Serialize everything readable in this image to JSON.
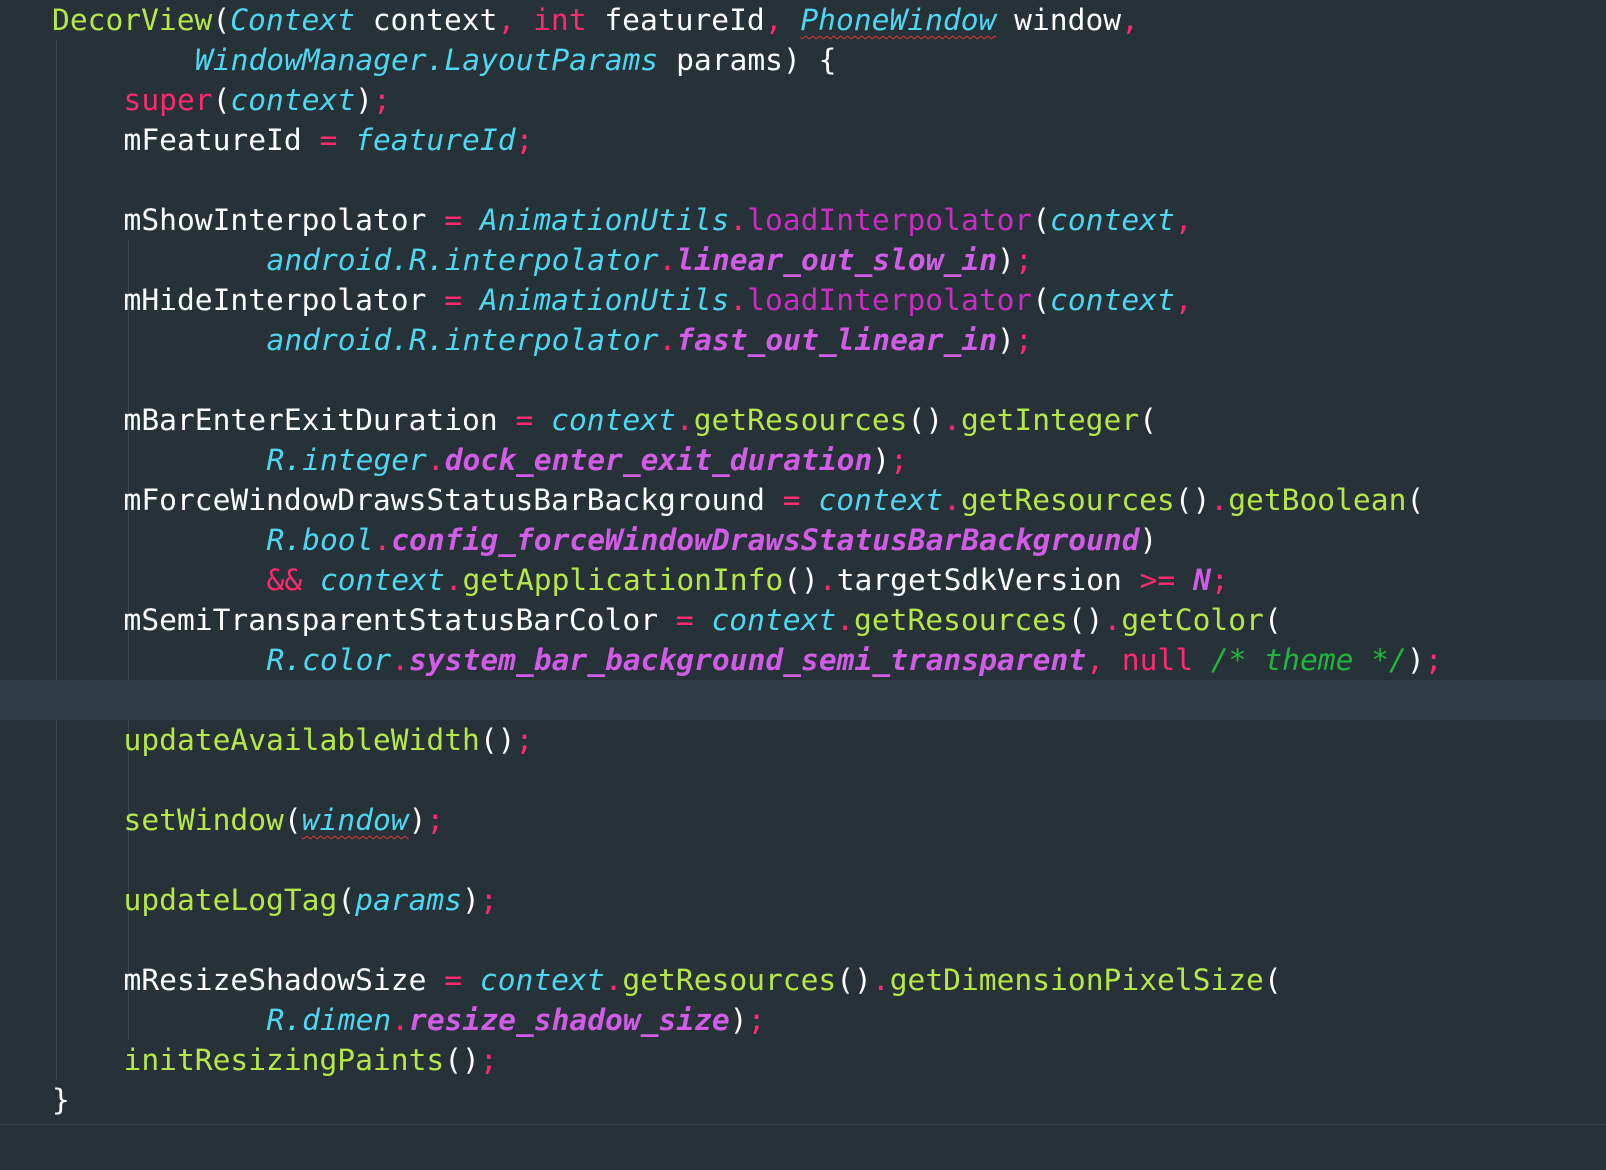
{
  "colors": {
    "background": "#263238",
    "current_line": "#2e3c44",
    "keyword": "#ff2a6d",
    "type": "#4fd6f0",
    "function": "#b4e84a",
    "library_function": "#c72ec2",
    "field": "#d15ce6",
    "comment": "#21b43f",
    "text": "#ffffff",
    "error_underline": "#d9363e"
  },
  "current_line_index": 17,
  "lines": [
    {
      "indent": 0,
      "tokens": [
        [
          "fn",
          "DecorView"
        ],
        [
          "plain",
          "("
        ],
        [
          "type",
          "Context"
        ],
        [
          "plain",
          " context"
        ],
        [
          "op",
          ", "
        ],
        [
          "kw",
          "int"
        ],
        [
          "plain",
          " featureId"
        ],
        [
          "op",
          ", "
        ],
        [
          "type squiggle",
          "PhoneWindow"
        ],
        [
          "plain",
          " window"
        ],
        [
          "op",
          ","
        ]
      ]
    },
    {
      "indent": 2,
      "tokens": [
        [
          "type",
          "WindowManager.LayoutParams"
        ],
        [
          "plain",
          " params) {"
        ]
      ]
    },
    {
      "indent": 1,
      "tokens": [
        [
          "kw",
          "super"
        ],
        [
          "plain",
          "("
        ],
        [
          "param",
          "context"
        ],
        [
          "plain",
          ")"
        ],
        [
          "op",
          ";"
        ]
      ]
    },
    {
      "indent": 1,
      "tokens": [
        [
          "plain",
          "mFeatureId "
        ],
        [
          "op",
          "="
        ],
        [
          "plain",
          " "
        ],
        [
          "param",
          "featureId"
        ],
        [
          "op",
          ";"
        ]
      ]
    },
    {
      "indent": 1,
      "tokens": []
    },
    {
      "indent": 1,
      "tokens": [
        [
          "plain",
          "mShowInterpolator "
        ],
        [
          "op",
          "="
        ],
        [
          "plain",
          " "
        ],
        [
          "type",
          "AnimationUtils"
        ],
        [
          "op",
          "."
        ],
        [
          "fnp",
          "loadInterpolator"
        ],
        [
          "plain",
          "("
        ],
        [
          "param",
          "context"
        ],
        [
          "op",
          ","
        ]
      ]
    },
    {
      "indent": 3,
      "tokens": [
        [
          "type",
          "android.R.interpolator"
        ],
        [
          "op",
          "."
        ],
        [
          "field",
          "linear_out_slow_in"
        ],
        [
          "plain",
          ")"
        ],
        [
          "op",
          ";"
        ]
      ]
    },
    {
      "indent": 1,
      "tokens": [
        [
          "plain",
          "mHideInterpolator "
        ],
        [
          "op",
          "="
        ],
        [
          "plain",
          " "
        ],
        [
          "type",
          "AnimationUtils"
        ],
        [
          "op",
          "."
        ],
        [
          "fnp",
          "loadInterpolator"
        ],
        [
          "plain",
          "("
        ],
        [
          "param",
          "context"
        ],
        [
          "op",
          ","
        ]
      ]
    },
    {
      "indent": 3,
      "tokens": [
        [
          "type",
          "android.R.interpolator"
        ],
        [
          "op",
          "."
        ],
        [
          "field",
          "fast_out_linear_in"
        ],
        [
          "plain",
          ")"
        ],
        [
          "op",
          ";"
        ]
      ]
    },
    {
      "indent": 1,
      "tokens": []
    },
    {
      "indent": 1,
      "tokens": [
        [
          "plain",
          "mBarEnterExitDuration "
        ],
        [
          "op",
          "="
        ],
        [
          "plain",
          " "
        ],
        [
          "param",
          "context"
        ],
        [
          "op",
          "."
        ],
        [
          "fn",
          "getResources"
        ],
        [
          "plain",
          "()"
        ],
        [
          "op",
          "."
        ],
        [
          "fn",
          "getInteger"
        ],
        [
          "plain",
          "("
        ]
      ]
    },
    {
      "indent": 3,
      "tokens": [
        [
          "type",
          "R.integer"
        ],
        [
          "op",
          "."
        ],
        [
          "field",
          "dock_enter_exit_duration"
        ],
        [
          "plain",
          ")"
        ],
        [
          "op",
          ";"
        ]
      ]
    },
    {
      "indent": 1,
      "tokens": [
        [
          "plain",
          "mForceWindowDrawsStatusBarBackground "
        ],
        [
          "op",
          "="
        ],
        [
          "plain",
          " "
        ],
        [
          "param",
          "context"
        ],
        [
          "op",
          "."
        ],
        [
          "fn",
          "getResources"
        ],
        [
          "plain",
          "()"
        ],
        [
          "op",
          "."
        ],
        [
          "fn",
          "getBoolean"
        ],
        [
          "plain",
          "("
        ]
      ]
    },
    {
      "indent": 3,
      "tokens": [
        [
          "type",
          "R.bool"
        ],
        [
          "op",
          "."
        ],
        [
          "field",
          "config_forceWindowDrawsStatusBarBackground"
        ],
        [
          "plain",
          ")"
        ]
      ]
    },
    {
      "indent": 3,
      "tokens": [
        [
          "op",
          "&&"
        ],
        [
          "plain",
          " "
        ],
        [
          "param",
          "context"
        ],
        [
          "op",
          "."
        ],
        [
          "fn",
          "getApplicationInfo"
        ],
        [
          "plain",
          "()"
        ],
        [
          "op",
          "."
        ],
        [
          "plain",
          "targetSdkVersion "
        ],
        [
          "op",
          ">="
        ],
        [
          "plain",
          " "
        ],
        [
          "field",
          "N"
        ],
        [
          "op",
          ";"
        ]
      ]
    },
    {
      "indent": 1,
      "tokens": [
        [
          "plain",
          "mSemiTransparentStatusBarColor "
        ],
        [
          "op",
          "="
        ],
        [
          "plain",
          " "
        ],
        [
          "param",
          "context"
        ],
        [
          "op",
          "."
        ],
        [
          "fn",
          "getResources"
        ],
        [
          "plain",
          "()"
        ],
        [
          "op",
          "."
        ],
        [
          "fn",
          "getColor"
        ],
        [
          "plain",
          "("
        ]
      ]
    },
    {
      "indent": 3,
      "tokens": [
        [
          "type",
          "R.color"
        ],
        [
          "op",
          "."
        ],
        [
          "field",
          "system_bar_background_semi_transparent"
        ],
        [
          "op",
          ","
        ],
        [
          "plain",
          " "
        ],
        [
          "kw",
          "null"
        ],
        [
          "plain",
          " "
        ],
        [
          "comment",
          "/* theme */"
        ],
        [
          "plain",
          ")"
        ],
        [
          "op",
          ";"
        ]
      ]
    },
    {
      "indent": 1,
      "tokens": []
    },
    {
      "indent": 1,
      "tokens": [
        [
          "fn",
          "updateAvailableWidth"
        ],
        [
          "plain",
          "()"
        ],
        [
          "op",
          ";"
        ]
      ]
    },
    {
      "indent": 1,
      "tokens": []
    },
    {
      "indent": 1,
      "tokens": [
        [
          "fn",
          "setWindow"
        ],
        [
          "plain",
          "("
        ],
        [
          "param squiggle",
          "window"
        ],
        [
          "plain",
          ")"
        ],
        [
          "op",
          ";"
        ]
      ]
    },
    {
      "indent": 1,
      "tokens": []
    },
    {
      "indent": 1,
      "tokens": [
        [
          "fn",
          "updateLogTag"
        ],
        [
          "plain",
          "("
        ],
        [
          "param",
          "params"
        ],
        [
          "plain",
          ")"
        ],
        [
          "op",
          ";"
        ]
      ]
    },
    {
      "indent": 1,
      "tokens": []
    },
    {
      "indent": 1,
      "tokens": [
        [
          "plain",
          "mResizeShadowSize "
        ],
        [
          "op",
          "="
        ],
        [
          "plain",
          " "
        ],
        [
          "param",
          "context"
        ],
        [
          "op",
          "."
        ],
        [
          "fn",
          "getResources"
        ],
        [
          "plain",
          "()"
        ],
        [
          "op",
          "."
        ],
        [
          "fn",
          "getDimensionPixelSize"
        ],
        [
          "plain",
          "("
        ]
      ]
    },
    {
      "indent": 3,
      "tokens": [
        [
          "type",
          "R.dimen"
        ],
        [
          "op",
          "."
        ],
        [
          "field",
          "resize_shadow_size"
        ],
        [
          "plain",
          ")"
        ],
        [
          "op",
          ";"
        ]
      ]
    },
    {
      "indent": 1,
      "tokens": [
        [
          "fn",
          "initResizingPaints"
        ],
        [
          "plain",
          "()"
        ],
        [
          "op",
          ";"
        ]
      ]
    },
    {
      "indent": 0,
      "tokens": [
        [
          "plain",
          "}"
        ]
      ]
    }
  ]
}
